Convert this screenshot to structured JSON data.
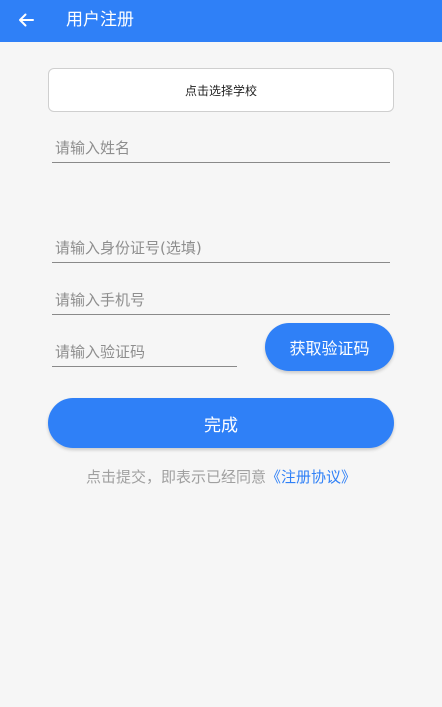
{
  "header": {
    "title": "用户注册",
    "back_icon": "arrow-left-icon"
  },
  "form": {
    "school_button_label": "点击选择学校",
    "name_placeholder": "请输入姓名",
    "id_placeholder": "请输入身份证号(选填)",
    "phone_placeholder": "请输入手机号",
    "code_placeholder": "请输入验证码",
    "get_code_label": "获取验证码",
    "submit_label": "完成"
  },
  "agreement": {
    "prefix": "点击提交，即表示已经同意",
    "link_text": "《注册协议》"
  },
  "colors": {
    "primary": "#2f80f7",
    "background": "#f6f6f6"
  }
}
